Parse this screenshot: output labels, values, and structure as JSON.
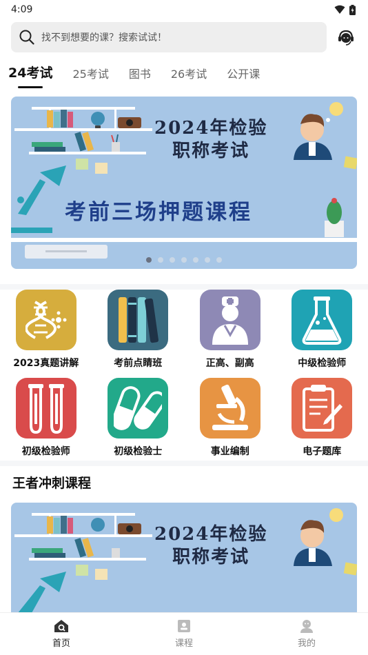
{
  "status": {
    "time": "4:09"
  },
  "search": {
    "placeholder": "找不到想要的课？搜索试试！"
  },
  "tabs": [
    {
      "label": "24考试",
      "active": true
    },
    {
      "label": "25考试",
      "active": false
    },
    {
      "label": "图书",
      "active": false
    },
    {
      "label": "26考试",
      "active": false
    },
    {
      "label": "公开课",
      "active": false
    }
  ],
  "banner": {
    "title_line1": "2024年检验",
    "title_line2": "职称考试",
    "subtitle": "考前三场押题课程",
    "dot_count": 7,
    "active_dot": 1
  },
  "categories": [
    {
      "label": "2023真题讲解",
      "color": "#d6ad3d",
      "icon": "dna-icon"
    },
    {
      "label": "考前点睛班",
      "color": "#3b6b80",
      "icon": "books-icon"
    },
    {
      "label": "正高、副高",
      "color": "#8e89b5",
      "icon": "doctor-icon"
    },
    {
      "label": "中级检验师",
      "color": "#1fa3b4",
      "icon": "flask-icon"
    },
    {
      "label": "初级检验师",
      "color": "#d94b4b",
      "icon": "test-tubes-icon"
    },
    {
      "label": "初级检验士",
      "color": "#22a98a",
      "icon": "capsules-icon"
    },
    {
      "label": "事业编制",
      "color": "#e79443",
      "icon": "microscope-icon"
    },
    {
      "label": "电子题库",
      "color": "#e46a4e",
      "icon": "clipboard-icon"
    }
  ],
  "section": {
    "title": "王者冲刺课程"
  },
  "course_banner": {
    "title_line1": "2024年检验",
    "title_line2": "职称考试"
  },
  "bottom_nav": [
    {
      "label": "首页",
      "icon": "home-icon",
      "active": true
    },
    {
      "label": "课程",
      "icon": "course-icon",
      "active": false
    },
    {
      "label": "我的",
      "icon": "profile-icon",
      "active": false
    }
  ]
}
